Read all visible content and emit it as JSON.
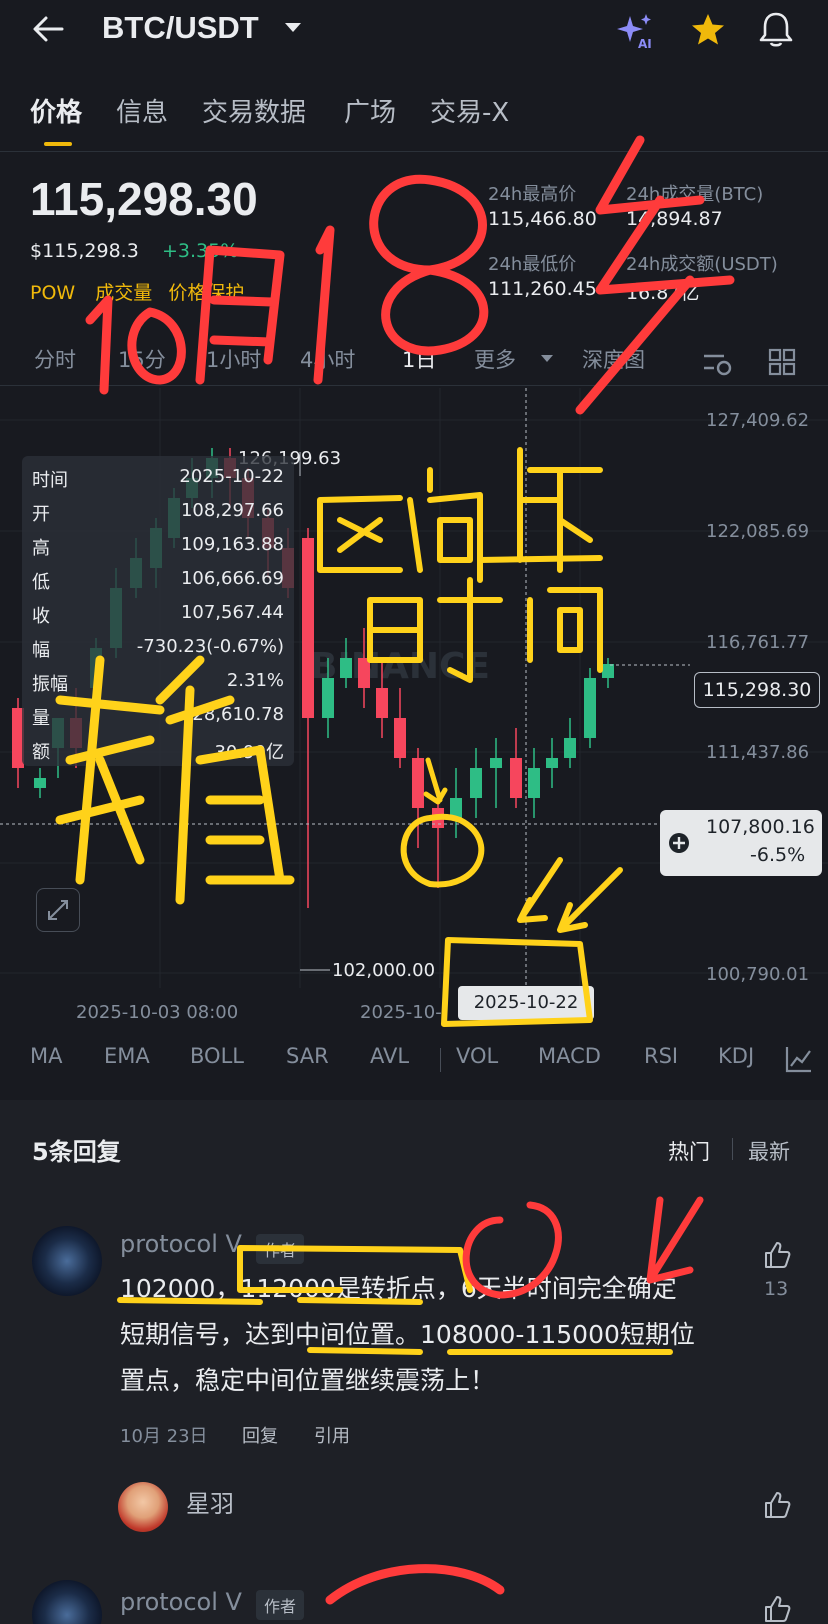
{
  "header": {
    "pair": "BTC/USDT",
    "icons": [
      "back-arrow-icon",
      "chevron-down-icon",
      "ai-sparkle-icon",
      "star-icon",
      "bell-icon"
    ],
    "ai_label": "AI"
  },
  "tabs": [
    {
      "label": "价格",
      "active": true
    },
    {
      "label": "信息"
    },
    {
      "label": "交易数据"
    },
    {
      "label": "广场"
    },
    {
      "label": "交易-X"
    }
  ],
  "ticker": {
    "last_price": "115,298.30",
    "usd_price": "$115,298.3",
    "change": "+3.35%",
    "tag_pow": "POW",
    "tag_volume": "成交量",
    "tag_protect": "价格保护",
    "stats": {
      "high_label": "24h最高价",
      "high_value": "115,466.80",
      "vol_btc_label": "24h成交量(BTC)",
      "vol_btc_value": "14,894.87",
      "low_label": "24h最低价",
      "low_value": "111,260.45",
      "vol_usdt_label": "24h成交额(USDT)",
      "vol_usdt_value": "16.87亿"
    }
  },
  "intervals": [
    "分时",
    "15分",
    "1小时",
    "4小时",
    "1日",
    "更多",
    "深度图"
  ],
  "chart_labels": {
    "axis": [
      "127,409.62",
      "122,085.69",
      "116,761.77",
      "111,437.86",
      "100,790.01"
    ],
    "current_price": "115,298.30",
    "cross_price": "107,800.16",
    "cross_pct": "-6.5%",
    "high_marker": "126,199.63",
    "low_marker": "102,000.00",
    "date_left": "2025-10-03 08:00",
    "date_mid": "2025-10-",
    "date_tag": "2025-10-22",
    "watermark": "BINANCE"
  },
  "tooltip": [
    {
      "k": "时间",
      "v": "2025-10-22"
    },
    {
      "k": "开",
      "v": "108,297.66"
    },
    {
      "k": "高",
      "v": "109,163.88"
    },
    {
      "k": "低",
      "v": "106,666.69"
    },
    {
      "k": "收",
      "v": "107,567.44"
    },
    {
      "k": "幅",
      "v": "-730.23(-0.67%)"
    },
    {
      "k": "振幅",
      "v": "2.31%"
    },
    {
      "k": "量",
      "v": "28,610.78"
    },
    {
      "k": "额",
      "v": "30.90亿"
    }
  ],
  "indicators": [
    "MA",
    "EMA",
    "BOLL",
    "SAR",
    "AVL",
    "VOL",
    "MACD",
    "RSI",
    "KDJ"
  ],
  "comments_header": {
    "count": "5条回复",
    "hot": "热门",
    "latest": "最新"
  },
  "comments": [
    {
      "author": "protocol V",
      "badge": "作者",
      "line1": "102000，112000是转折点，6天半时间完全确定",
      "line2": "短期信号，达到中间位置。108000-115000短期位",
      "line3": "置点，稳定中间位置继续震荡上！",
      "date": "10月 23日",
      "reply": "回复",
      "quote": "引用",
      "likes": "13"
    },
    {
      "author": "星羽"
    },
    {
      "author": "protocol V",
      "badge": "作者"
    }
  ],
  "handwriting": {
    "title": "10月18多",
    "range": "区间上下",
    "time": "时间",
    "precise": "精"
  },
  "colors": {
    "up": "#2ebd85",
    "down": "#f6465d",
    "accent": "#f0b90b",
    "ink_red": "#ff3b3b",
    "ink_yellow": "#ffd21a"
  }
}
